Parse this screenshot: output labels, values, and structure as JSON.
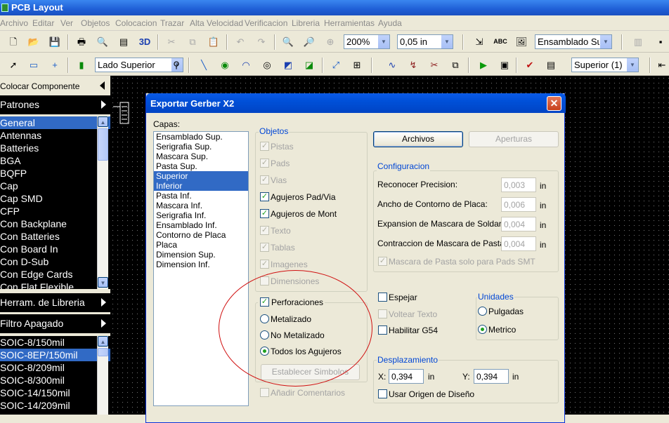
{
  "app": {
    "title": "PCB Layout"
  },
  "menu": [
    "Archivo",
    "Editar",
    "Ver",
    "Objetos",
    "Colocacion",
    "Trazar",
    "Alta Velocidad",
    "Verificacion",
    "Libreria",
    "Herramientas",
    "Ayuda"
  ],
  "toolbar1": {
    "zoom": "200%",
    "grid": "0,05 in",
    "view": "Ensamblado Sup",
    "label_3d": "3D",
    "label_abc": "ABC"
  },
  "toolbar2": {
    "side": "Lado Superior",
    "layer": "Superior (1)"
  },
  "left_panel": {
    "place_component": "Colocar Componente",
    "patterns": "Patrones",
    "categories": [
      "General",
      "Antennas",
      "Batteries",
      "BGA",
      "BQFP",
      "Cap",
      "Cap SMD",
      "CFP",
      "Con Backplane",
      "Con Batteries",
      "Con Board In",
      "Con D-Sub",
      "Con Edge Cards",
      "Con Flat Flexible"
    ],
    "selected_category": "General",
    "library_tools": "Herram. de Libreria",
    "filter": "Filtro Apagado",
    "parts": [
      "SOIC-8/150mil",
      "SOIC-8EP/150mil",
      "SOIC-8/209mil",
      "SOIC-8/300mil",
      "SOIC-14/150mil",
      "SOIC-14/209mil"
    ],
    "selected_part": "SOIC-8EP/150mil"
  },
  "dialog": {
    "title": "Exportar Gerber X2",
    "close": "✕",
    "layers_label": "Capas:",
    "layers": [
      "Ensamblado Sup.",
      "Serigrafia Sup.",
      "Mascara Sup.",
      "Pasta Sup.",
      "Superior",
      "Inferior",
      "Pasta Inf.",
      "Mascara Inf.",
      "Serigrafia Inf.",
      "Ensamblado Inf.",
      "Contorno de Placa",
      "Placa",
      "Dimension Sup.",
      "Dimension Inf."
    ],
    "selected_layers": [
      "Superior",
      "Inferior"
    ],
    "objects_title": "Objetos",
    "objects": [
      {
        "label": "Pistas",
        "checked": true,
        "enabled": false
      },
      {
        "label": "Pads",
        "checked": true,
        "enabled": false
      },
      {
        "label": "Vias",
        "checked": true,
        "enabled": false
      },
      {
        "label": "Agujeros Pad/Via",
        "checked": true,
        "enabled": true
      },
      {
        "label": "Agujeros de Mont",
        "checked": true,
        "enabled": true
      },
      {
        "label": "Texto",
        "checked": true,
        "enabled": false
      },
      {
        "label": "Tablas",
        "checked": true,
        "enabled": false
      },
      {
        "label": "Imagenes",
        "checked": true,
        "enabled": false
      },
      {
        "label": "Dimensiones",
        "checked": false,
        "enabled": false
      }
    ],
    "drills": {
      "label": "Perforaciones",
      "checked": true
    },
    "drill_options": [
      {
        "label": "Metalizado",
        "selected": false
      },
      {
        "label": "No Metalizado",
        "selected": false
      },
      {
        "label": "Todos los Agujeros",
        "selected": true
      }
    ],
    "set_symbols": "Establecer Simbolos",
    "add_comments": "Añadir Comentarios",
    "files_button": "Archivos",
    "apertures_button": "Aperturas",
    "config_title": "Configuracion",
    "config": [
      {
        "label": "Reconocer Precision:",
        "value": "0,003",
        "unit": "in"
      },
      {
        "label": "Ancho de Contorno de Placa:",
        "value": "0,006",
        "unit": "in"
      },
      {
        "label": "Expansion de Mascara de Soldar",
        "value": "0,004",
        "unit": "in"
      },
      {
        "label": "Contraccion de Mascara de Pasta",
        "value": "0,004",
        "unit": "in"
      }
    ],
    "paste_mask_smt": "Mascara de Pasta solo para Pads SMT",
    "mirror": "Espejar",
    "flip_text": "Voltear Texto",
    "enable_g54": "Habilitar G54",
    "units_title": "Unidades",
    "units": [
      {
        "label": "Pulgadas",
        "selected": false
      },
      {
        "label": "Metrico",
        "selected": true
      }
    ],
    "offset_title": "Desplazamiento",
    "offset_x_label": "X:",
    "offset_x": "0,394",
    "offset_x_unit": "in",
    "offset_y_label": "Y:",
    "offset_y": "0,394",
    "offset_y_unit": "in",
    "use_origin": "Usar Origen de Diseño"
  },
  "colors": {
    "selection": "#316ac5",
    "title_blue": "#0a5ae6",
    "annotation_red": "#d01010"
  }
}
